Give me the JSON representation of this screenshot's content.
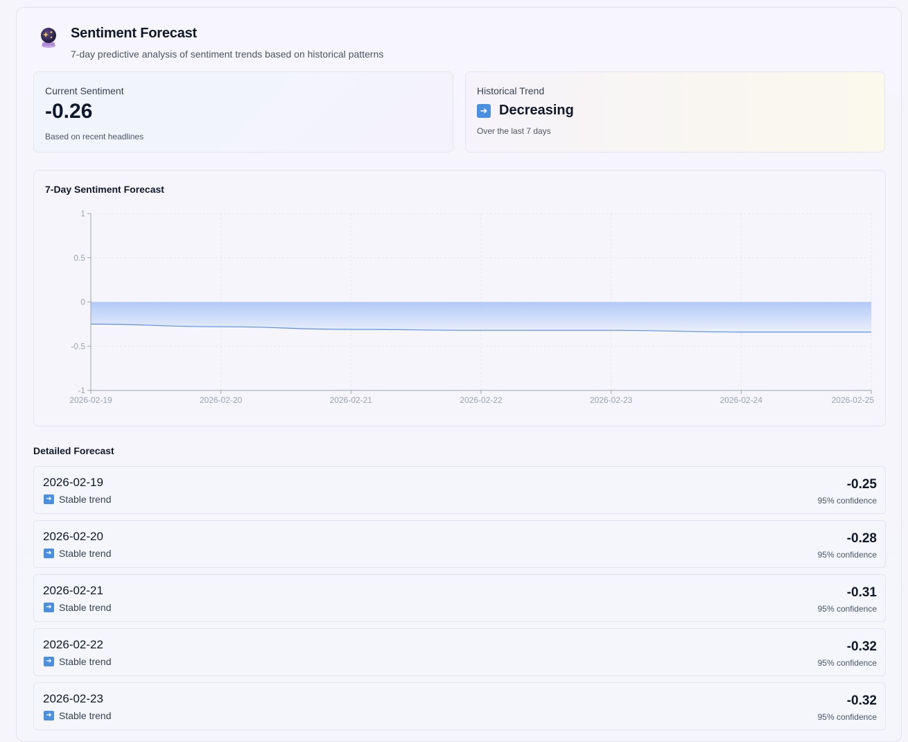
{
  "header": {
    "icon": "crystal-ball-icon",
    "title": "Sentiment Forecast",
    "subtitle": "7-day predictive analysis of sentiment trends based on historical patterns"
  },
  "current": {
    "label": "Current Sentiment",
    "value": "-0.26",
    "note": "Based on recent headlines"
  },
  "trend": {
    "label": "Historical Trend",
    "icon": "right-arrow-icon",
    "value": "Decreasing",
    "note": "Over the last 7 days"
  },
  "chart_data": {
    "type": "area",
    "title": "7-Day Sentiment Forecast",
    "x": [
      "2026-02-19",
      "2026-02-20",
      "2026-02-21",
      "2026-02-22",
      "2026-02-23",
      "2026-02-24",
      "2026-02-25"
    ],
    "series": [
      {
        "values": [
          -0.25,
          -0.28,
          -0.31,
          -0.32,
          -0.32,
          -0.34,
          -0.34
        ]
      }
    ],
    "ylim": [
      -1,
      1
    ],
    "yticks": [
      1,
      0.5,
      0,
      -0.5,
      -1
    ],
    "ytick_labels": [
      "1",
      "0.5",
      "0",
      "-0.5",
      "-1"
    ],
    "grid": true,
    "colors": {
      "line": "#5b8def",
      "fill_top": "#aec6f6",
      "fill_bottom": "#e9effc",
      "grid": "#e5e7eb",
      "axis": "#9ca3af"
    }
  },
  "details": {
    "title": "Detailed Forecast",
    "rows": [
      {
        "date": "2026-02-19",
        "trend": "Stable trend",
        "value": "-0.25",
        "confidence": "95% confidence"
      },
      {
        "date": "2026-02-20",
        "trend": "Stable trend",
        "value": "-0.28",
        "confidence": "95% confidence"
      },
      {
        "date": "2026-02-21",
        "trend": "Stable trend",
        "value": "-0.31",
        "confidence": "95% confidence"
      },
      {
        "date": "2026-02-22",
        "trend": "Stable trend",
        "value": "-0.32",
        "confidence": "95% confidence"
      },
      {
        "date": "2026-02-23",
        "trend": "Stable trend",
        "value": "-0.32",
        "confidence": "95% confidence"
      }
    ]
  }
}
